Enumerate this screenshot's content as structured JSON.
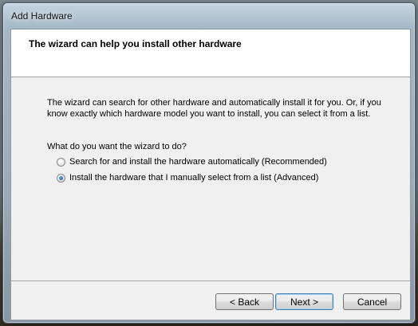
{
  "window": {
    "title": "Add Hardware"
  },
  "header": {
    "title": "The wizard can help you install other hardware"
  },
  "body": {
    "description": "The wizard can search for other hardware and automatically install it for you. Or, if you know exactly which hardware model you want to install, you can select it from a list.",
    "question": "What do you want the wizard to do?",
    "options": [
      {
        "label": "Search for and install the hardware automatically (Recommended)",
        "selected": false
      },
      {
        "label": "Install the hardware that I manually select from a list (Advanced)",
        "selected": true
      }
    ]
  },
  "buttons": {
    "back": "< Back",
    "next": "Next >",
    "cancel": "Cancel"
  },
  "colors": {
    "dialog_background": "#f0f0f0",
    "header_background": "#ffffff",
    "default_button_border": "#3c7fb1"
  }
}
